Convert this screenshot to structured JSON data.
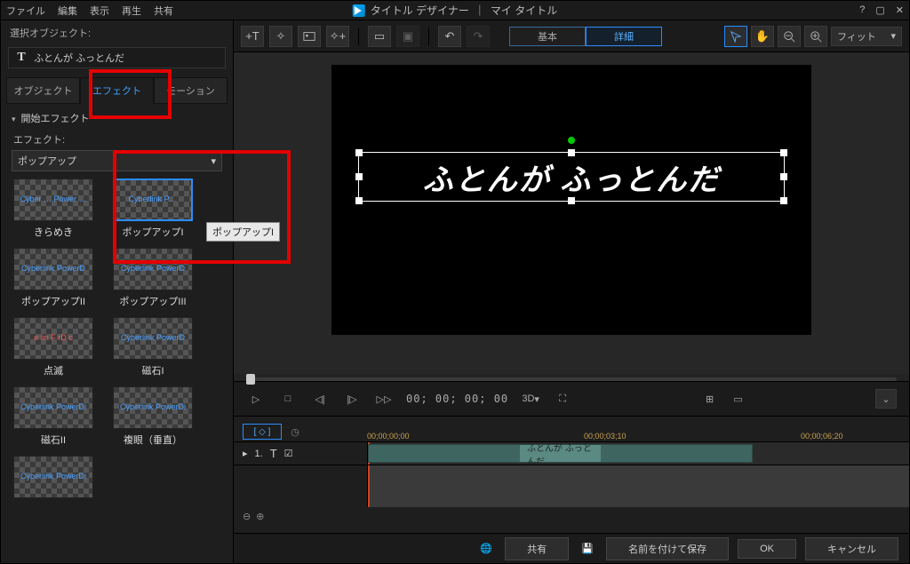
{
  "menu": {
    "file": "ファイル",
    "edit": "編集",
    "view": "表示",
    "play": "再生",
    "share": "共有"
  },
  "window": {
    "title": "タイトル デザイナー",
    "subtitle": "マイ タイトル"
  },
  "left": {
    "selobj": "選択オブジェクト:",
    "objname": "ふとんが ふっとんだ",
    "tabs": {
      "object": "オブジェクト",
      "effect": "エフェクト",
      "motion": "モーション"
    },
    "section": "開始エフェクト",
    "efflabel": "エフェクト:",
    "dropdown": "ポップアップ",
    "thumbs": [
      {
        "label": "きらめき",
        "preview": "Cyber …\nPower …"
      },
      {
        "label": "ポップアップI",
        "preview": "Cyberlink\nP…",
        "selected": true
      },
      {
        "label": "ポップアップII",
        "preview": "Cyberlink\nPowerD"
      },
      {
        "label": "ポップアップIII",
        "preview": "Cyberlink\nPowerD"
      },
      {
        "label": "点滅",
        "preview": "e  lin\nF   rD  c",
        "red": true
      },
      {
        "label": "磁石I",
        "preview": "Cyberlink\nPowerD"
      },
      {
        "label": "磁石II",
        "preview": "Cyberlink\nPowerDi"
      },
      {
        "label": "複眼（垂直）",
        "preview": "Cyberlink\nPowerDi"
      },
      {
        "label": "",
        "preview": "Cyberlink\nPowerDi"
      }
    ],
    "tooltip": "ポップアップI"
  },
  "toolbar": {
    "basic": "基本",
    "advanced": "詳細",
    "fit": "フィット"
  },
  "canvas": {
    "text": "ふとんが ふっとんだ"
  },
  "player": {
    "timecode": "00; 00; 00; 00",
    "threeD": "3D"
  },
  "timeline": {
    "ticks": [
      "00;00;00;00",
      "00;00;03;10",
      "00;00;06;20"
    ],
    "track": {
      "num": "1.",
      "clip": "ふとんが ふっとんだ"
    }
  },
  "footer": {
    "share": "共有",
    "saveas": "名前を付けて保存",
    "ok": "OK",
    "cancel": "キャンセル"
  }
}
